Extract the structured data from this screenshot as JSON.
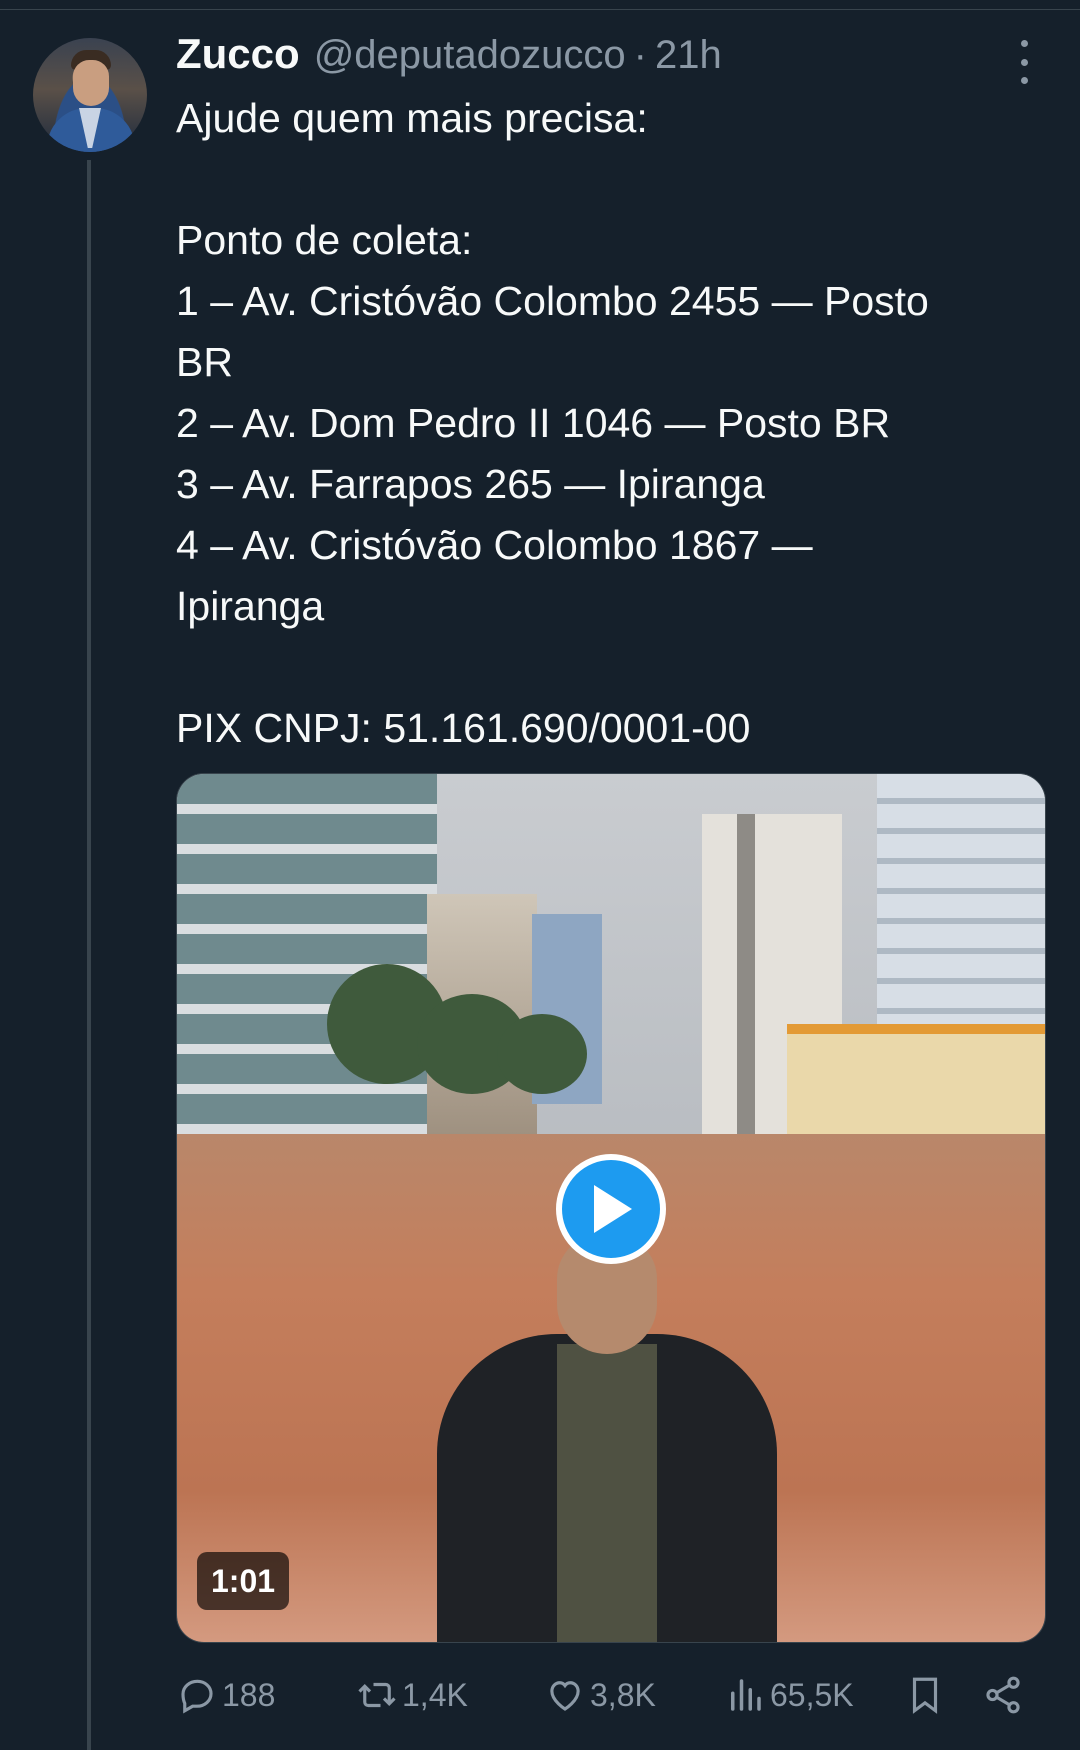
{
  "tweet": {
    "author_name": "Zucco",
    "author_handle": "@deputadozucco",
    "separator": "·",
    "timestamp": "21h",
    "text_lines": [
      "Ajude quem mais precisa:",
      "",
      "Ponto de coleta:",
      "1 – Av. Cristóvão Colombo 2455 — Posto",
      "BR",
      "2 – Av. Dom Pedro II 1046 — Posto BR",
      "3 – Av. Farrapos 265 — Ipiranga",
      "4 – Av. Cristóvão Colombo 1867 —",
      "Ipiranga",
      "",
      "PIX CNPJ: 51.161.690/0001-00"
    ]
  },
  "media": {
    "type": "video",
    "duration": "1:01"
  },
  "actions": {
    "replies": "188",
    "reposts": "1,4K",
    "likes": "3,8K",
    "views": "65,5K"
  },
  "icons": {
    "more": "more-vertical-icon",
    "reply": "reply-icon",
    "repost": "repost-icon",
    "like": "heart-icon",
    "views": "views-icon",
    "bookmark": "bookmark-icon",
    "share": "share-icon",
    "play": "play-icon"
  },
  "colors": {
    "background": "#15202b",
    "text": "#f7f9f9",
    "muted": "#8b98a5",
    "accent": "#1d9bf0"
  }
}
